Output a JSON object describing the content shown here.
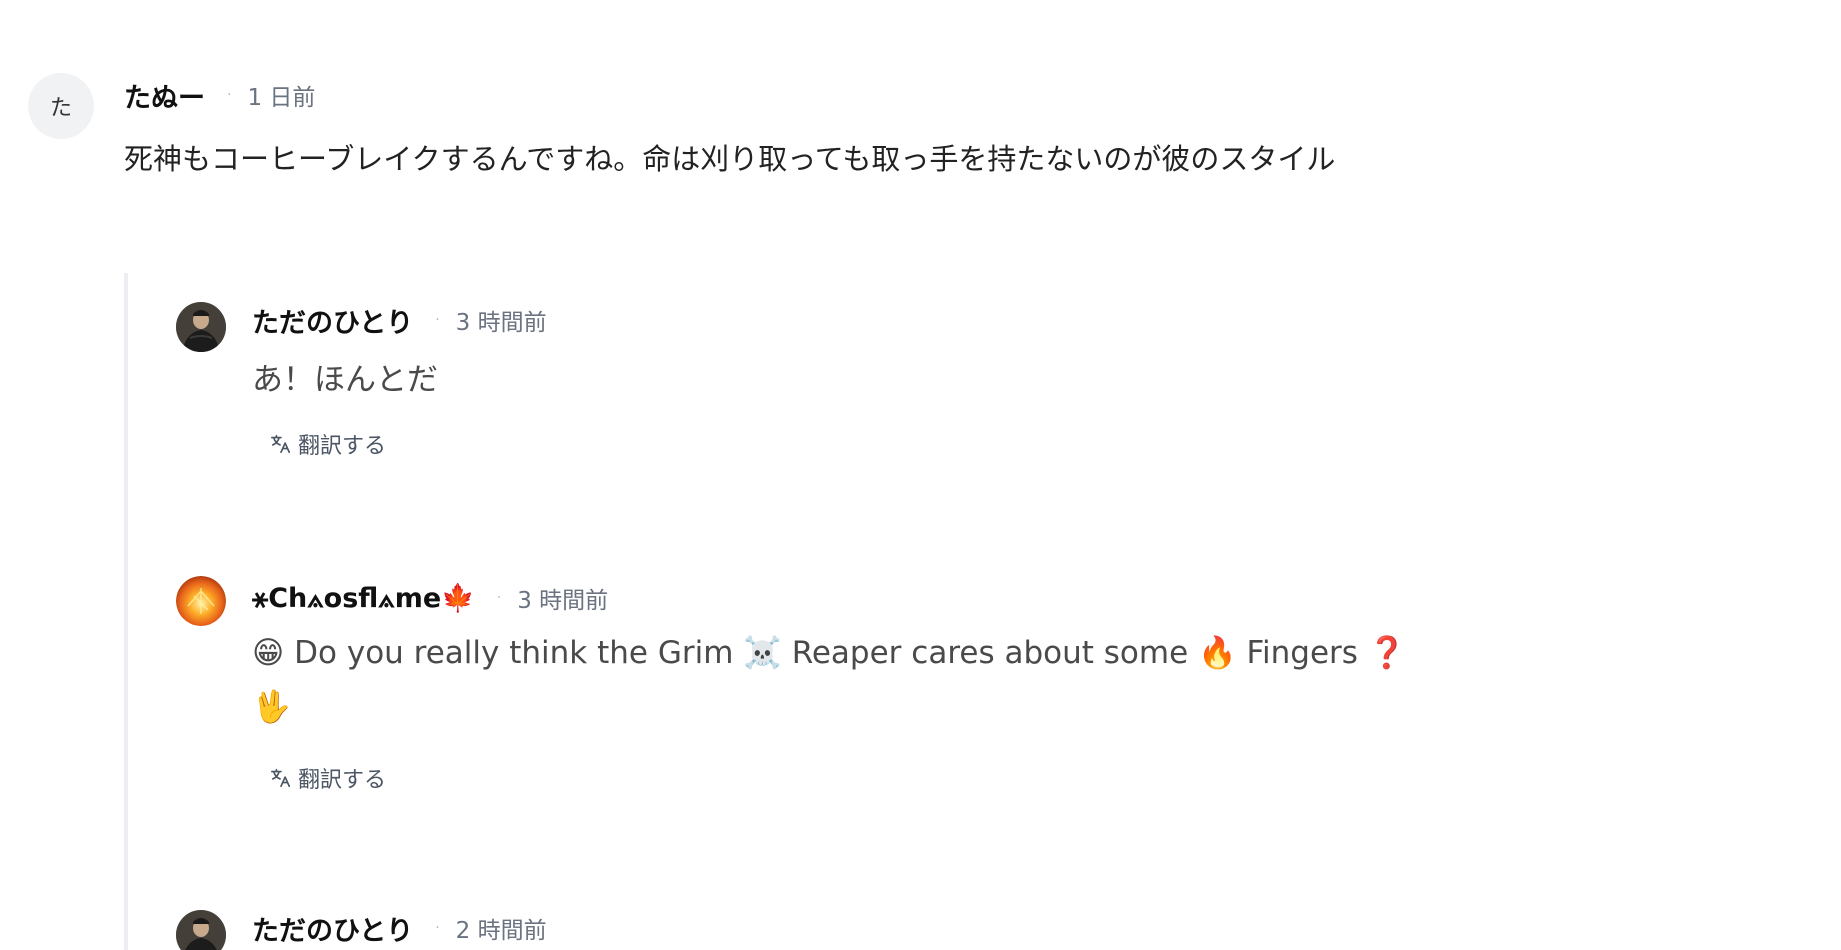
{
  "comments": [
    {
      "avatar_letter": "た",
      "author": "たぬー",
      "time": "1 日前",
      "text": "死神もコーヒーブレイクするんですね。命は刈り取っても取っ手を持たないのが彼のスタイル"
    }
  ],
  "replies": [
    {
      "author": "ただのひとり",
      "time": "3 時間前",
      "text": "あ！ほんとだ",
      "translate_label": "翻訳する"
    },
    {
      "author": "⚹Ch⟑osfl⟑me🍁",
      "time": "3 時間前",
      "text_line1": "😁 Do you really think the Grim ☠️ Reaper cares about some 🔥 Fingers ❓",
      "text_line2": "🖖",
      "translate_label": "翻訳する"
    },
    {
      "author": "ただのひとり",
      "time": "2 時間前"
    }
  ],
  "meta_separator": "·",
  "icons": {
    "translate": "translate-icon"
  },
  "colors": {
    "thread_line": "#eceef1",
    "muted_text": "#6b7280",
    "avatar_bg": "#f1f2f4"
  }
}
